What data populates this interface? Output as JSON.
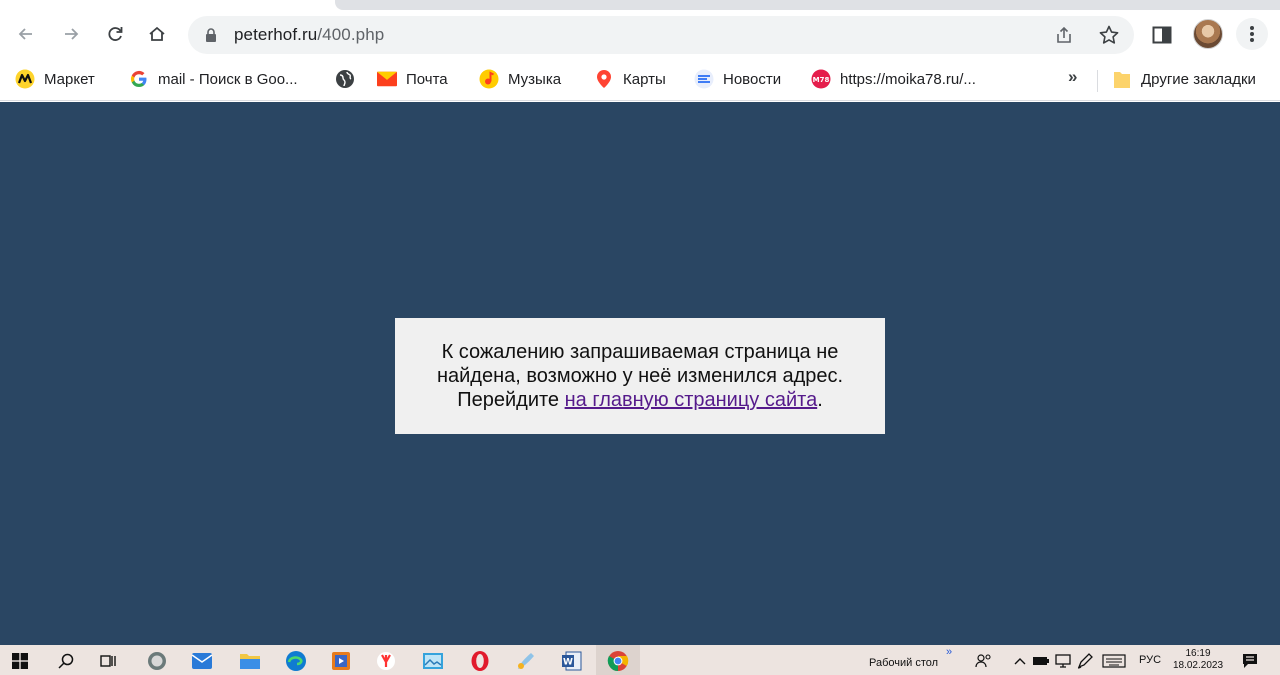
{
  "browser": {
    "url_host": "peterhof.ru",
    "url_path": "/400.php"
  },
  "bookmarks": [
    {
      "label": "Маркет",
      "icon": "yandex-market-icon"
    },
    {
      "label": "mail - Поиск в Goo...",
      "icon": "google-g-icon"
    },
    {
      "label": "",
      "icon": "globe-icon"
    },
    {
      "label": "Почта",
      "icon": "mail-envelope-icon"
    },
    {
      "label": "Музыка",
      "icon": "music-icon"
    },
    {
      "label": "Карты",
      "icon": "map-pin-icon"
    },
    {
      "label": "Новости",
      "icon": "news-icon"
    },
    {
      "label": "https://moika78.ru/...",
      "icon": "m78-icon"
    }
  ],
  "bookmarks_overflow": "»",
  "other_bookmarks": "Другие закладки",
  "notice": {
    "line1": "К сожалению запрашиваемая страница не",
    "line2": "найдена, возможно у неё изменился адрес.",
    "line3_prefix": "Перейдите ",
    "link_text": "на главную страницу сайта",
    "line3_suffix": "."
  },
  "taskbar": {
    "desktop_label": "Рабочий стол",
    "desktop_chevron": "»",
    "language": "РУС",
    "time": "16:19",
    "date": "18.02.2023"
  },
  "colors": {
    "page_background": "#2a4663",
    "notice_background": "#f0f0f0",
    "link": "#551a8b",
    "taskbar": "#ede4e0"
  }
}
